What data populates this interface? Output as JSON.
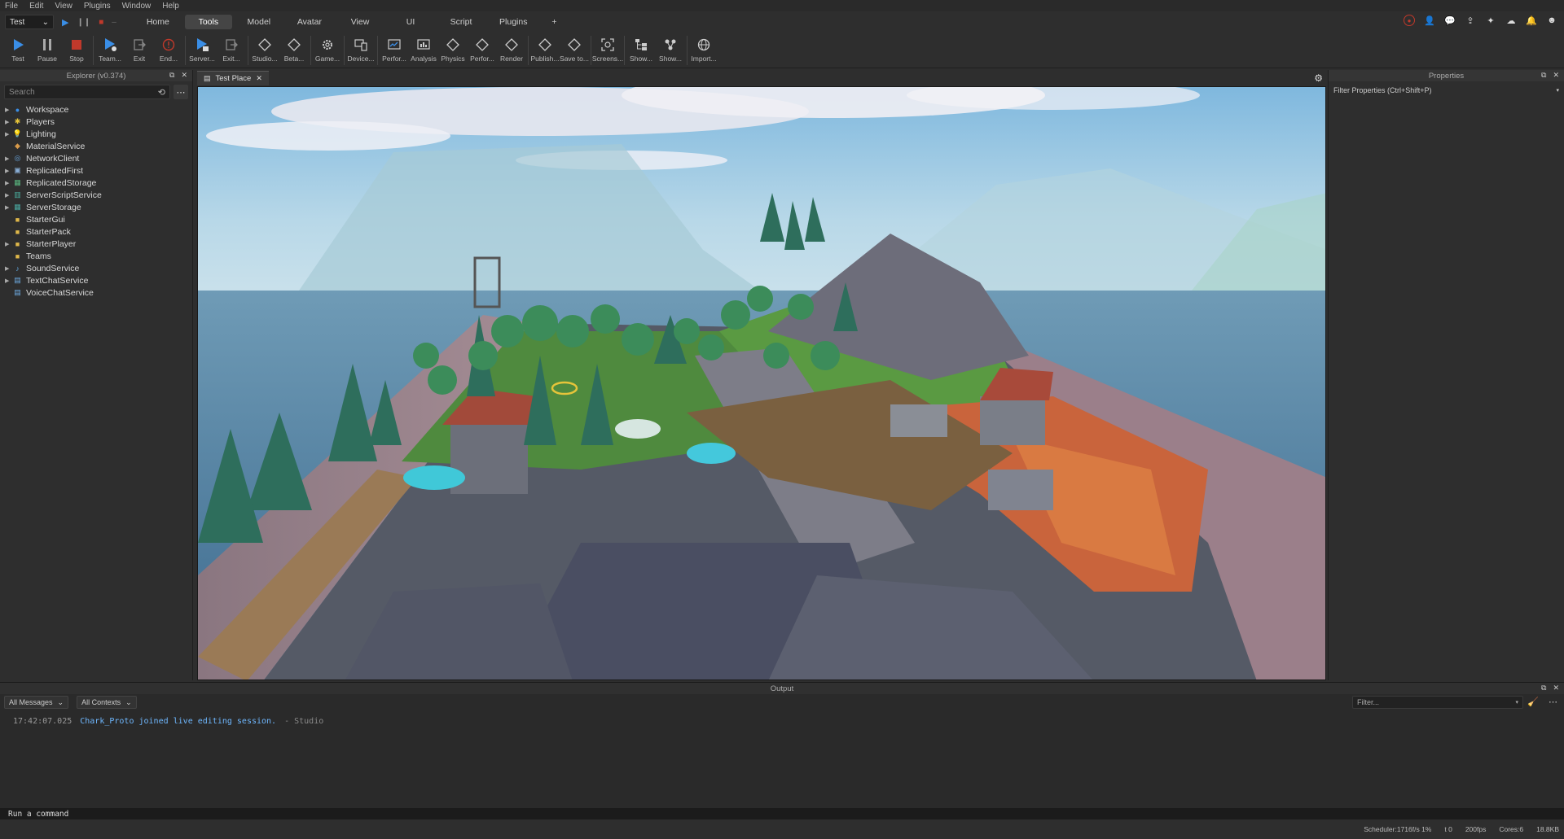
{
  "menubar": [
    "File",
    "Edit",
    "View",
    "Plugins",
    "Window",
    "Help"
  ],
  "mode_select": "Test",
  "ribbon_tabs": [
    "Home",
    "Tools",
    "Model",
    "Avatar",
    "View",
    "UI",
    "Script",
    "Plugins"
  ],
  "active_tab": "Tools",
  "toolbar": {
    "test": "Test",
    "pause": "Pause",
    "stop": "Stop",
    "team": "Team...",
    "exit": "Exit",
    "end": "End...",
    "server": "Server...",
    "exit2": "Exit...",
    "studio": "Studio...",
    "beta": "Beta...",
    "game": "Game...",
    "device": "Device...",
    "perfor1": "Perfor...",
    "analysis": "Analysis",
    "physics": "Physics",
    "perfor2": "Perfor...",
    "render": "Render",
    "publish": "Publish...",
    "saveto": "Save to...",
    "screens": "Screens...",
    "show1": "Show...",
    "show2": "Show...",
    "import": "Import..."
  },
  "explorer": {
    "title": "Explorer (v0.374)",
    "search_placeholder": "Search",
    "items": [
      {
        "label": "Workspace",
        "icon": "globe-icon",
        "expandable": true
      },
      {
        "label": "Players",
        "icon": "players-icon",
        "expandable": true
      },
      {
        "label": "Lighting",
        "icon": "lightbulb-icon",
        "expandable": true
      },
      {
        "label": "MaterialService",
        "icon": "material-icon",
        "expandable": false
      },
      {
        "label": "NetworkClient",
        "icon": "network-icon",
        "expandable": true
      },
      {
        "label": "ReplicatedFirst",
        "icon": "replicated-icon",
        "expandable": true
      },
      {
        "label": "ReplicatedStorage",
        "icon": "storage-icon",
        "expandable": true
      },
      {
        "label": "ServerScriptService",
        "icon": "server-script-icon",
        "expandable": true
      },
      {
        "label": "ServerStorage",
        "icon": "server-storage-icon",
        "expandable": true
      },
      {
        "label": "StarterGui",
        "icon": "folder-icon",
        "expandable": false
      },
      {
        "label": "StarterPack",
        "icon": "folder-icon",
        "expandable": false
      },
      {
        "label": "StarterPlayer",
        "icon": "folder-icon",
        "expandable": true
      },
      {
        "label": "Teams",
        "icon": "folder-icon",
        "expandable": false
      },
      {
        "label": "SoundService",
        "icon": "sound-icon",
        "expandable": true
      },
      {
        "label": "TextChatService",
        "icon": "chat-icon",
        "expandable": true
      },
      {
        "label": "VoiceChatService",
        "icon": "voice-icon",
        "expandable": false
      }
    ]
  },
  "doc_tab": "Test Place",
  "properties": {
    "title": "Properties",
    "filter_placeholder": "Filter Properties (Ctrl+Shift+P)"
  },
  "output": {
    "title": "Output",
    "messages_filter": "All Messages",
    "contexts_filter": "All Contexts",
    "filter_placeholder": "Filter...",
    "log": {
      "time": "17:42:07.025",
      "message": "Chark_Proto joined live editing session.",
      "source": "- Studio"
    }
  },
  "command_bar": "Run a command",
  "status": {
    "scheduler": "Scheduler:1716f/s 1%",
    "t": "t 0",
    "fps": "200fps",
    "cores": "Cores:6",
    "mem": "18.8KB"
  },
  "colors": {
    "accent": "#3a8ee6",
    "stop": "#c0392b",
    "log_blue": "#6fb8ff"
  }
}
